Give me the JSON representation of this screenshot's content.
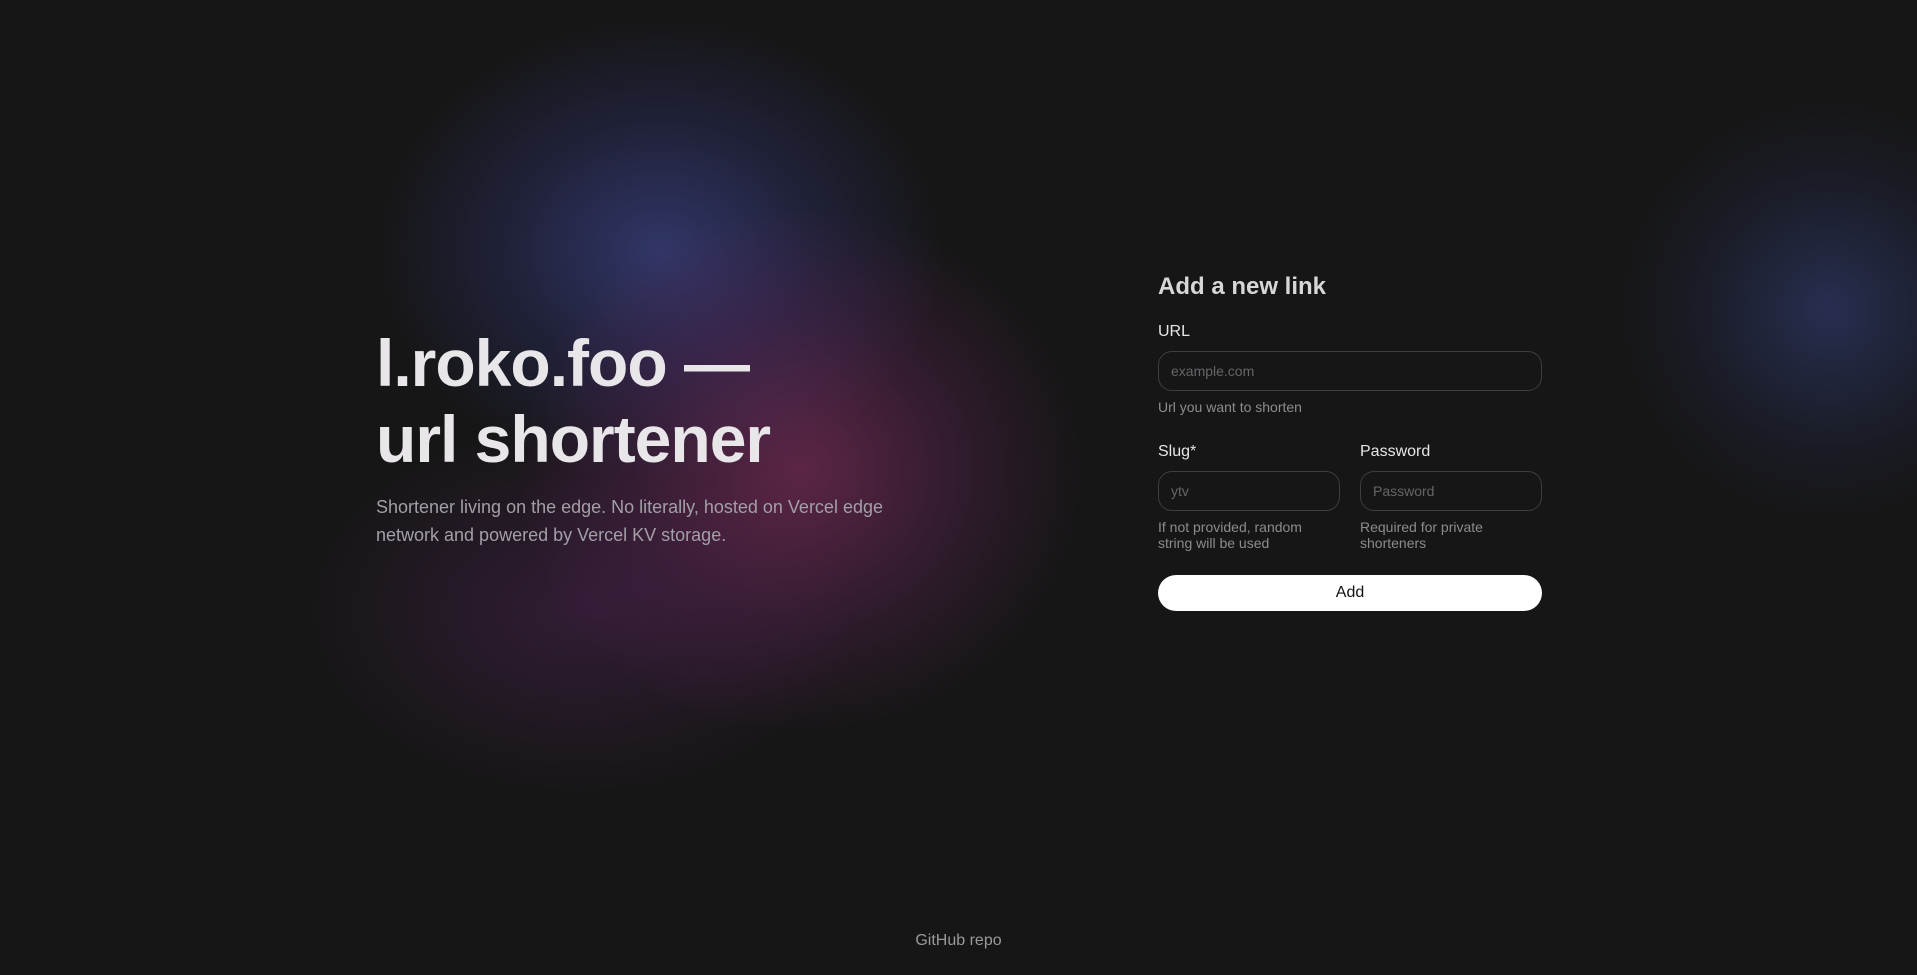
{
  "hero": {
    "title_line1": "l.roko.foo —",
    "title_line2": "url shortener",
    "description": "Shortener living on the edge. No literally, hosted on Vercel edge network and powered by Vercel KV storage."
  },
  "form": {
    "heading": "Add a new link",
    "url": {
      "label": "URL",
      "placeholder": "example.com",
      "value": "",
      "hint": "Url you want to shorten"
    },
    "slug": {
      "label": "Slug*",
      "placeholder": "ytv",
      "value": "",
      "hint": "If not provided, random string will be used"
    },
    "password": {
      "label": "Password",
      "placeholder": "Password",
      "value": "",
      "hint": "Required for private shorteners"
    },
    "submit_label": "Add"
  },
  "footer": {
    "github_link": "GitHub repo"
  },
  "colors": {
    "background": "#161616",
    "heading_text": "#e9e6ea",
    "muted_text": "#a39fa6",
    "button_bg": "#ffffff",
    "glow_blue": "#3e4a9a",
    "glow_pink": "#8a3068"
  }
}
